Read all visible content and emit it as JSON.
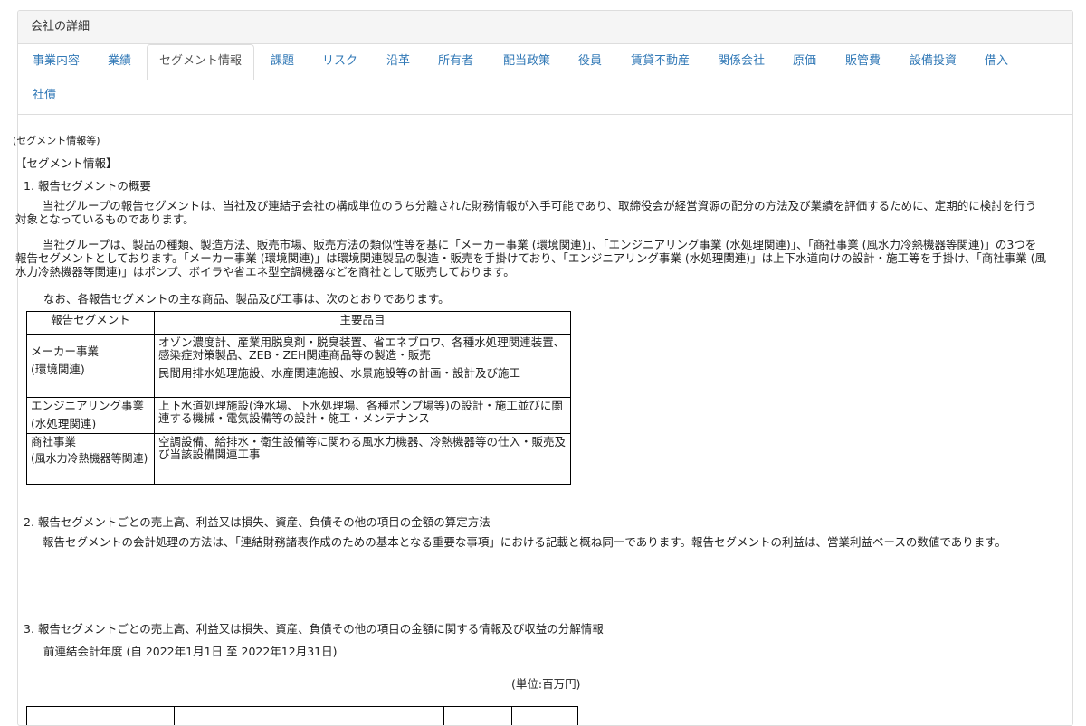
{
  "panel": {
    "title": "会社の詳細"
  },
  "tabs": [
    {
      "label": "事業内容"
    },
    {
      "label": "業績"
    },
    {
      "label": "セグメント情報",
      "active": true
    },
    {
      "label": "課題"
    },
    {
      "label": "リスク"
    },
    {
      "label": "沿革"
    },
    {
      "label": "所有者"
    },
    {
      "label": "配当政策"
    },
    {
      "label": "役員"
    },
    {
      "label": "賃貸不動産"
    },
    {
      "label": "関係会社"
    },
    {
      "label": "原価"
    },
    {
      "label": "販管費"
    },
    {
      "label": "設備投資"
    },
    {
      "label": "借入"
    },
    {
      "label": "社債"
    }
  ],
  "content": {
    "caption": "(セグメント情報等)",
    "heading": "【セグメント情報】",
    "s1_title": "1. 報告セグメントの概要",
    "s1_p1": "当社グループの報告セグメントは、当社及び連結子会社の構成単位のうち分離された財務情報が入手可能であり、取締役会が経営資源の配分の方法及び業績を評価するために、定期的に検討を行う対象となっているものであります。",
    "s1_p2": "当社グループは、製品の種類、製造方法、販売市場、販売方法の類似性等を基に「メーカー事業 (環境関連)」、「エンジニアリング事業 (水処理関連)」、「商社事業 (風水力冷熱機器等関連)」の3つを報告セグメントとしております。「メーカー事業 (環境関連)」は環境関連製品の製造・販売を手掛けており、「エンジニアリング事業 (水処理関連)」は上下水道向けの設計・施工等を手掛け、「商社事業 (風水力冷熱機器等関連)」はポンプ、ボイラや省エネ型空調機器などを商社として販売しております。",
    "s1_p3": "なお、各報告セグメントの主な商品、製品及び工事は、次のとおりであります。",
    "table": {
      "headers": [
        "報告セグメント",
        "主要品目"
      ],
      "rows": [
        {
          "seg_line1": "メーカー事業",
          "seg_line2": "(環境関連)",
          "items1": "オゾン濃度計、産業用脱臭剤・脱臭装置、省エネブロワ、各種水処理関連装置、感染症対策製品、ZEB・ZEH関連商品等の製造・販売",
          "items2": "民間用排水処理施設、水産関連施設、水景施設等の計画・設計及び施工"
        },
        {
          "seg_line1": "エンジニアリング事業",
          "seg_line2": "(水処理関連)",
          "items1": "上下水道処理施設(浄水場、下水処理場、各種ポンプ場等)の設計・施工並びに関連する機械・電気設備等の設計・施工・メンテナンス",
          "items2": ""
        },
        {
          "seg_line1": "商社事業",
          "seg_line2": "(風水力冷熱機器等関連)",
          "items1": "空調設備、給排水・衛生設備等に関わる風水力機器、冷熱機器等の仕入・販売及び当該設備関連工事",
          "items2": ""
        }
      ]
    },
    "s2_title": "2. 報告セグメントごとの売上高、利益又は損失、資産、負債その他の項目の金額の算定方法",
    "s2_p1": "報告セグメントの会計処理の方法は、「連結財務諸表作成のための基本となる重要な事項」における記載と概ね同一であります。報告セグメントの利益は、営業利益ベースの数値であります。",
    "s3_title": "3. 報告セグメントごとの売上高、利益又は損失、資産、負債その他の項目の金額に関する情報及び収益の分解情報",
    "s3_period": "前連結会計年度 (自 2022年1月1日 至 2022年12月31日)",
    "s3_unit": "(単位:百万円)"
  }
}
